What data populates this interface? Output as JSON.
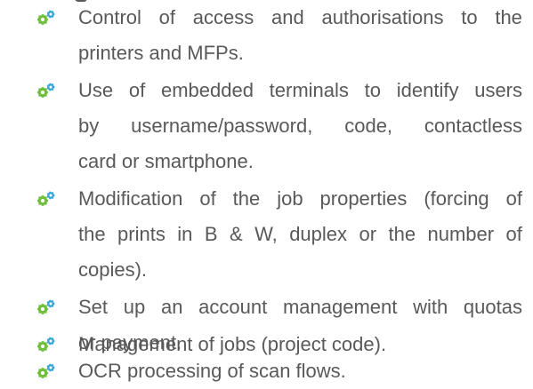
{
  "items": [
    {
      "lines": [
        [
          "Control",
          "of",
          "access",
          "and",
          "authorisations",
          "to",
          "the"
        ],
        [
          "printers and MFPs."
        ]
      ]
    },
    {
      "lines": [
        [
          "Use",
          "of",
          "embedded",
          "terminals",
          "to",
          "identify",
          "users"
        ],
        [
          "by",
          "username/password,",
          "code,",
          "contactless"
        ],
        [
          "card or smartphone."
        ]
      ]
    },
    {
      "lines": [
        [
          "Modification",
          "of",
          "the",
          "job",
          "properties",
          "(forcing",
          "of"
        ],
        [
          "the",
          "prints",
          "in",
          "B",
          "&",
          "W,",
          "duplex",
          "or",
          "the",
          "number",
          "of"
        ],
        [
          "copies)."
        ]
      ]
    },
    {
      "lines": [
        [
          "Set",
          "up",
          "an",
          "account",
          "management",
          "with",
          "quotas"
        ],
        [
          "or payment."
        ]
      ]
    },
    {
      "lines": [
        [
          "Management of jobs (project code)."
        ]
      ]
    },
    {
      "lines": [
        [
          "OCR processing of scan flows."
        ]
      ]
    }
  ],
  "bullet_icon": "gears-icon",
  "colors": {
    "text": "#595959",
    "gear_green": "#6fbf3d",
    "gear_blue": "#3aa7d8"
  }
}
